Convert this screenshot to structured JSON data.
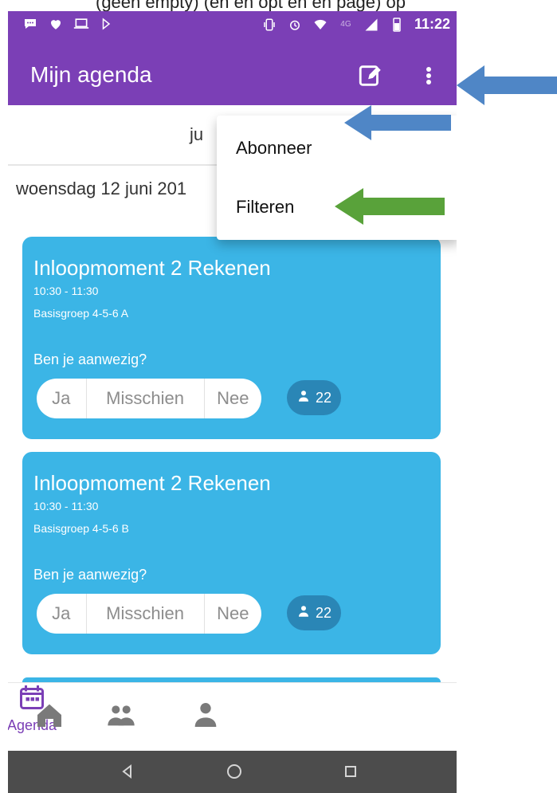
{
  "caption": "(geen empty) (en en opt en en page) op",
  "status_bar": {
    "time": "11:22",
    "signal_label": "4G",
    "icons_left": [
      "notification-icon",
      "heart-icon",
      "laptop-icon",
      "video-icon"
    ],
    "icons_right": [
      "vibrate-icon",
      "alarm-icon",
      "wifi-icon",
      "signal-icon",
      "battery-icon"
    ]
  },
  "app_bar": {
    "title": "Mijn agenda",
    "edit_icon": "edit-icon",
    "more_icon": "more-vert-icon"
  },
  "menu": {
    "items": [
      {
        "label": "Abonneer"
      },
      {
        "label": "Filteren"
      }
    ]
  },
  "header": {
    "month": "ju",
    "day": "woensdag 12 juni 201"
  },
  "events": [
    {
      "title": "Inloopmoment 2 Rekenen",
      "time": "10:30 - 11:30",
      "group": "Basisgroep 4-5-6 A",
      "question": "Ben je aanwezig?",
      "options": [
        "Ja",
        "Misschien",
        "Nee"
      ],
      "count": "22"
    },
    {
      "title": "Inloopmoment 2 Rekenen",
      "time": "10:30 - 11:30",
      "group": "Basisgroep 4-5-6 B",
      "question": "Ben je aanwezig?",
      "options": [
        "Ja",
        "Misschien",
        "Nee"
      ],
      "count": "22"
    }
  ],
  "bottom_nav": {
    "items": [
      {
        "icon": "home-icon"
      },
      {
        "icon": "group-icon"
      },
      {
        "icon": "person-icon"
      },
      {
        "icon": "calendar-icon",
        "label": "Agenda"
      }
    ]
  },
  "colors": {
    "purple": "#7b3fb6",
    "blue_card": "#3bb5e6",
    "count_badge": "#2a86b6",
    "arrow_blue": "#4f86c6",
    "arrow_green": "#59a23a",
    "system_nav": "#4c4c4c"
  }
}
